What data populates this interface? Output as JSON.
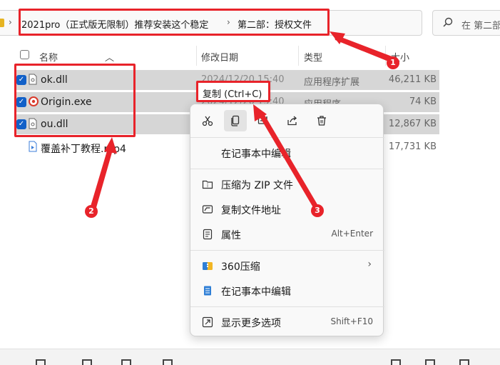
{
  "address_bar": {
    "crumb_1": "2021pro（正式版无限制）推荐安装这个稳定",
    "crumb_2": "第二部：授权文件",
    "separator": "›"
  },
  "search": {
    "placeholder": "在 第二部"
  },
  "columns": {
    "name": "名称",
    "date": "修改日期",
    "type": "类型",
    "size": "大小"
  },
  "files": [
    {
      "name": "ok.dll",
      "date": "2024/12/20 15:40",
      "type": "应用程序扩展",
      "size": "46,211 KB",
      "selected": true,
      "icon": "dll-file-icon"
    },
    {
      "name": "Origin.exe",
      "date": "2024/12/20 15:40",
      "type": "应用程序",
      "size": "74 KB",
      "selected": true,
      "icon": "origin-exe-icon"
    },
    {
      "name": "ou.dll",
      "date": "",
      "type": "",
      "size": "12,867 KB",
      "selected": true,
      "icon": "dll-file-icon"
    },
    {
      "name": "覆盖补丁教程.mp4",
      "date": "",
      "type": "",
      "size": "17,731 KB",
      "selected": false,
      "icon": "video-file-icon"
    }
  ],
  "tooltip": {
    "label": "复制 (Ctrl+C)"
  },
  "context_menu": {
    "icon_bar": [
      "cut-icon",
      "copy-icon",
      "rename-icon",
      "share-icon",
      "delete-icon"
    ],
    "items": [
      {
        "label": "在记事本中编辑",
        "shortcut": "",
        "icon": ""
      },
      {
        "label": "压缩为 ZIP 文件",
        "shortcut": "",
        "icon": "zip-icon"
      },
      {
        "label": "复制文件地址",
        "shortcut": "",
        "icon": "copy-path-icon"
      },
      {
        "label": "属性",
        "shortcut": "Alt+Enter",
        "icon": "properties-icon"
      },
      {
        "label": "360压缩",
        "shortcut": "›",
        "icon": "360zip-icon"
      },
      {
        "label": "在记事本中编辑",
        "shortcut": "",
        "icon": "notepad-icon"
      },
      {
        "label": "显示更多选项",
        "shortcut": "Shift+F10",
        "icon": "more-options-icon"
      }
    ]
  },
  "annotations": {
    "badge_1": "1",
    "badge_2": "2",
    "badge_3": "3"
  },
  "colors": {
    "highlight": "#e8232a",
    "selection": "#d6d6d6",
    "checkbox": "#1160c8"
  }
}
